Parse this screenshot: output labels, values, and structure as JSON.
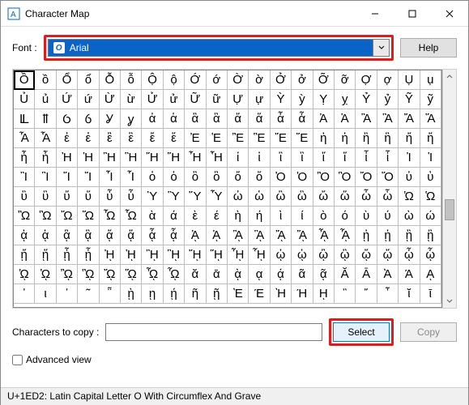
{
  "window": {
    "title": "Character Map",
    "min_icon": "minimize",
    "max_icon": "maximize",
    "close_icon": "close"
  },
  "font_row": {
    "label": "Font :",
    "selected_font": "Arial",
    "help_button": "Help"
  },
  "grid": {
    "selected_index": 0,
    "rows": [
      [
        "Ồ",
        "ồ",
        "Ổ",
        "ổ",
        "Ỗ",
        "ỗ",
        "Ộ",
        "ộ",
        "Ớ",
        "ớ",
        "Ờ",
        "ờ",
        "Ở",
        "ở",
        "Ỡ",
        "ỡ",
        "Ợ",
        "ợ",
        "Ụ",
        "ụ"
      ],
      [
        "Ủ",
        "ủ",
        "Ứ",
        "ứ",
        "Ừ",
        "ừ",
        "Ử",
        "ử",
        "Ữ",
        "ữ",
        "Ự",
        "ự",
        "Ỳ",
        "ỳ",
        "Ỵ",
        "ỵ",
        "Ỷ",
        "ỷ",
        "Ỹ",
        "ỹ"
      ],
      [
        "Ỻ",
        "ỻ",
        "Ỽ",
        "ỽ",
        "Ỿ",
        "ỿ",
        "ἀ",
        "ἁ",
        "ἂ",
        "ἃ",
        "ἄ",
        "ἅ",
        "ἆ",
        "ἇ",
        "Ἀ",
        "Ἁ",
        "Ἂ",
        "Ἃ",
        "Ἄ",
        "Ἅ"
      ],
      [
        "Ἆ",
        "Ἇ",
        "ἐ",
        "ἑ",
        "ἒ",
        "ἓ",
        "ἔ",
        "ἕ",
        "Ἐ",
        "Ἑ",
        "Ἒ",
        "Ἓ",
        "Ἔ",
        "Ἕ",
        "ἠ",
        "ἡ",
        "ἢ",
        "ἣ",
        "ἤ",
        "ἥ"
      ],
      [
        "ἦ",
        "ἧ",
        "Ἠ",
        "Ἡ",
        "Ἢ",
        "Ἣ",
        "Ἤ",
        "Ἥ",
        "Ἦ",
        "Ἧ",
        "ἰ",
        "ἱ",
        "ἲ",
        "ἳ",
        "ἴ",
        "ἵ",
        "ἶ",
        "ἷ",
        "Ἰ",
        "Ἱ"
      ],
      [
        "Ἲ",
        "Ἳ",
        "Ἴ",
        "Ἵ",
        "Ἶ",
        "Ἷ",
        "ὀ",
        "ὁ",
        "ὂ",
        "ὃ",
        "ὄ",
        "ὅ",
        "Ὀ",
        "Ὁ",
        "Ὂ",
        "Ὃ",
        "Ὄ",
        "Ὅ",
        "ὐ",
        "ὑ"
      ],
      [
        "ὒ",
        "ὓ",
        "ὔ",
        "ὕ",
        "ὖ",
        "ὗ",
        "Ὑ",
        "Ὓ",
        "Ὕ",
        "Ὗ",
        "ὠ",
        "ὡ",
        "ὢ",
        "ὣ",
        "ὤ",
        "ὥ",
        "ὦ",
        "ὧ",
        "Ὠ",
        "Ὡ"
      ],
      [
        "Ὢ",
        "Ὣ",
        "Ὤ",
        "Ὥ",
        "Ὦ",
        "Ὧ",
        "ὰ",
        "ά",
        "ὲ",
        "έ",
        "ὴ",
        "ή",
        "ὶ",
        "ί",
        "ὸ",
        "ό",
        "ὺ",
        "ύ",
        "ὼ",
        "ώ"
      ],
      [
        "ᾀ",
        "ᾁ",
        "ᾂ",
        "ᾃ",
        "ᾄ",
        "ᾅ",
        "ᾆ",
        "ᾇ",
        "ᾈ",
        "ᾉ",
        "ᾊ",
        "ᾋ",
        "ᾌ",
        "ᾍ",
        "ᾎ",
        "ᾏ",
        "ᾐ",
        "ᾑ",
        "ᾒ",
        "ᾓ"
      ],
      [
        "ᾔ",
        "ᾕ",
        "ᾖ",
        "ᾗ",
        "ᾘ",
        "ᾙ",
        "ᾚ",
        "ᾛ",
        "ᾜ",
        "ᾝ",
        "ᾞ",
        "ᾟ",
        "ᾠ",
        "ᾡ",
        "ᾢ",
        "ᾣ",
        "ᾤ",
        "ᾥ",
        "ᾦ",
        "ᾧ"
      ],
      [
        "ᾨ",
        "ᾩ",
        "ᾪ",
        "ᾫ",
        "ᾬ",
        "ᾭ",
        "ᾮ",
        "ᾯ",
        "ᾰ",
        "ᾱ",
        "ᾲ",
        "ᾳ",
        "ᾴ",
        "ᾶ",
        "ᾷ",
        "Ᾰ",
        "Ᾱ",
        "Ὰ",
        "Ά",
        "ᾼ"
      ],
      [
        "᾽",
        "ι",
        "᾿",
        "῀",
        "῁",
        "ῂ",
        "ῃ",
        "ῄ",
        "ῆ",
        "ῇ",
        "Ὲ",
        "Έ",
        "Ὴ",
        "Ή",
        "ῌ",
        "῍",
        "῎",
        "῏",
        "ῐ",
        "ῑ"
      ]
    ]
  },
  "copy_row": {
    "label": "Characters to copy :",
    "value": "",
    "select_button": "Select",
    "copy_button": "Copy"
  },
  "advanced": {
    "checked": false,
    "label": "Advanced view"
  },
  "status": "U+1ED2: Latin Capital Letter O With Circumflex And Grave"
}
